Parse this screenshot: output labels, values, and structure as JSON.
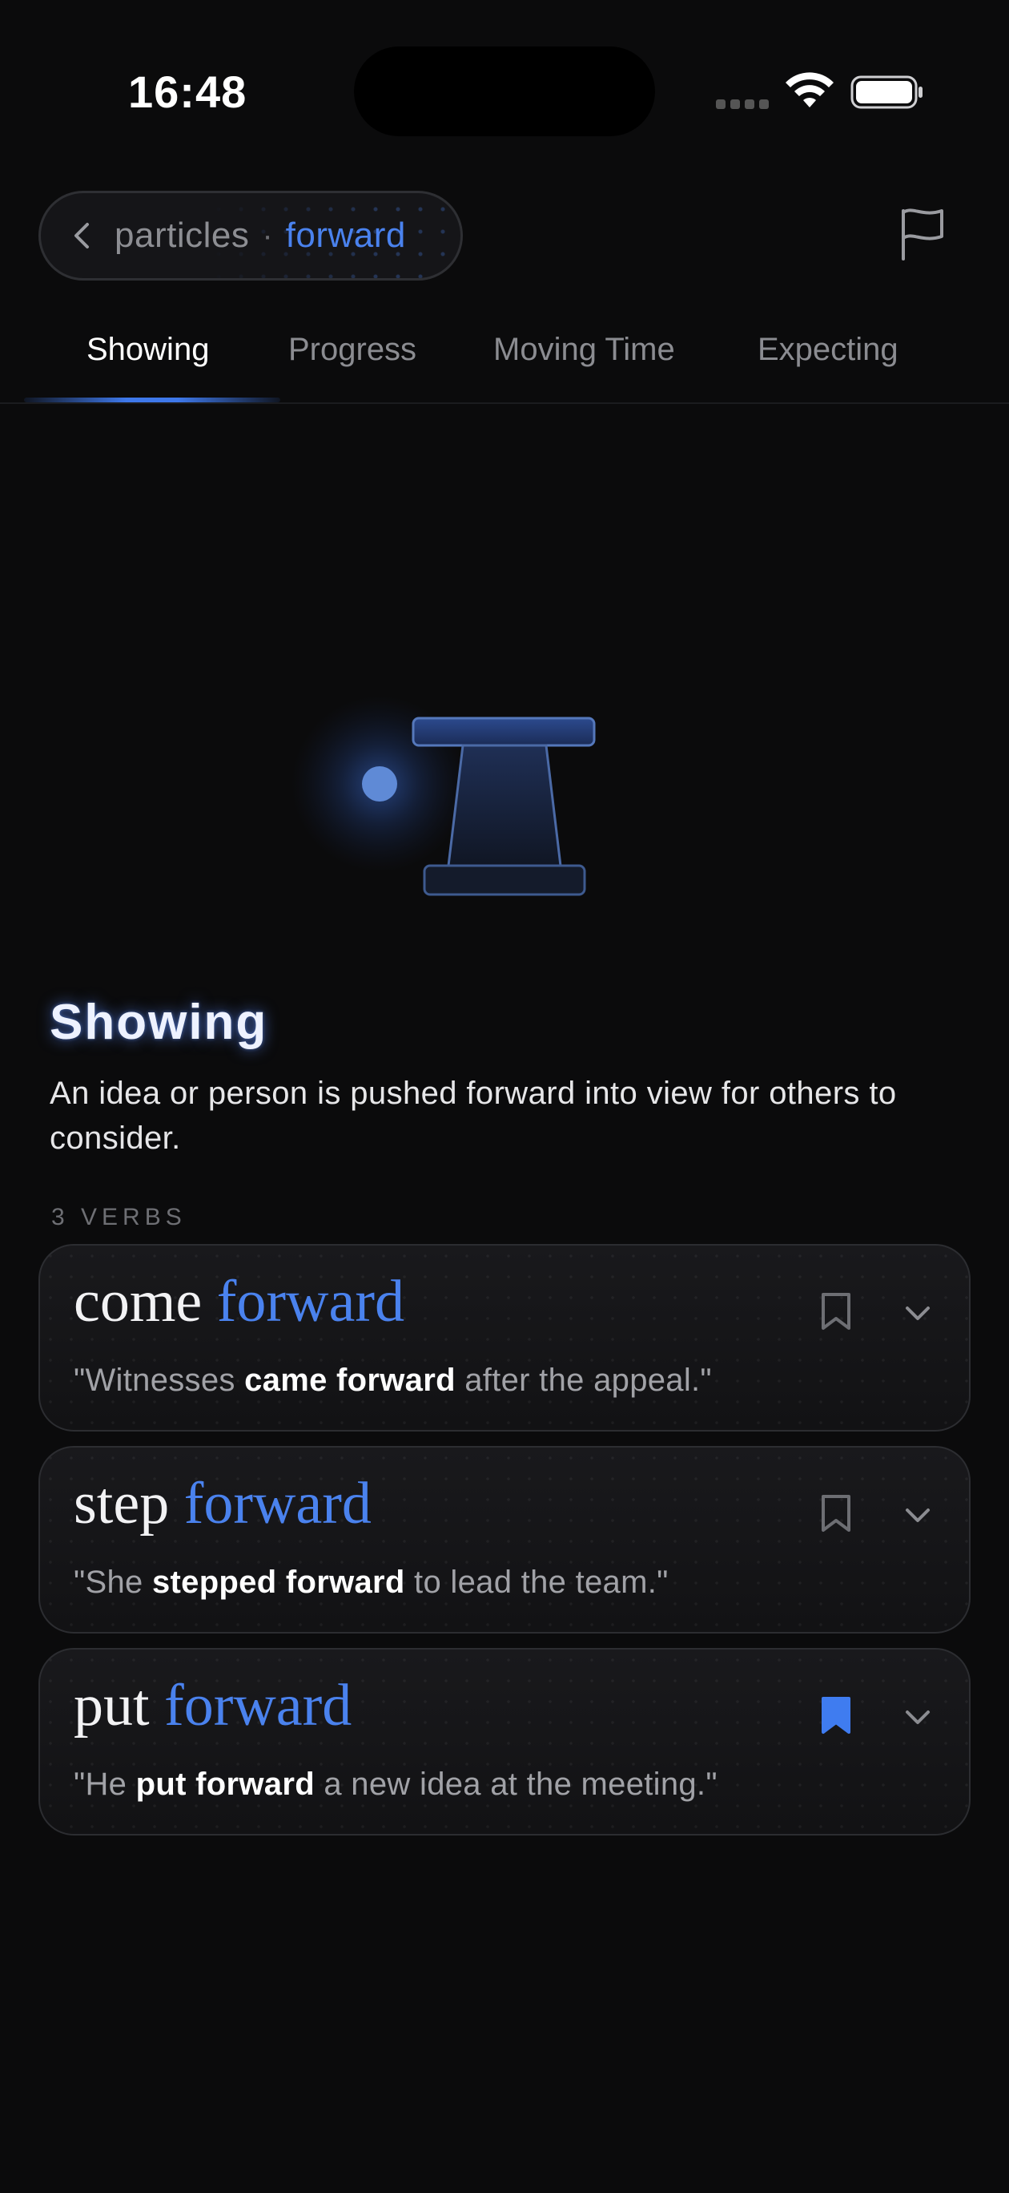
{
  "status_bar": {
    "time": "16:48"
  },
  "header": {
    "breadcrumb_parent": "particles",
    "breadcrumb_separator": "·",
    "breadcrumb_current": "forward",
    "back_icon": "chevron-left-icon",
    "flag_icon": "flag-icon"
  },
  "tabs": [
    {
      "label": "Showing",
      "active": true
    },
    {
      "label": "Progress",
      "active": false
    },
    {
      "label": "Moving Time",
      "active": false
    },
    {
      "label": "Expecting",
      "active": false
    }
  ],
  "meaning": {
    "title": "Showing",
    "description": "An idea or person is pushed forward into view for others to consider.",
    "count_label": "3 VERBS"
  },
  "verbs": [
    {
      "verb": "come",
      "particle": "forward",
      "example_before": "\"Witnesses ",
      "example_bold": "came forward",
      "example_after": " after the appeal.\"",
      "bookmarked": false
    },
    {
      "verb": "step",
      "particle": "forward",
      "example_before": "\"She ",
      "example_bold": "stepped forward",
      "example_after": " to lead the team.\"",
      "bookmarked": false
    },
    {
      "verb": "put",
      "particle": "forward",
      "example_before": "\"He ",
      "example_bold": "put forward",
      "example_after": " a new idea at the meeting.\"",
      "bookmarked": true
    }
  ],
  "colors": {
    "accent": "#4a82ee",
    "background": "#0b0b0c",
    "card_border": "#2c2d31",
    "muted_text": "#8b8c91"
  }
}
